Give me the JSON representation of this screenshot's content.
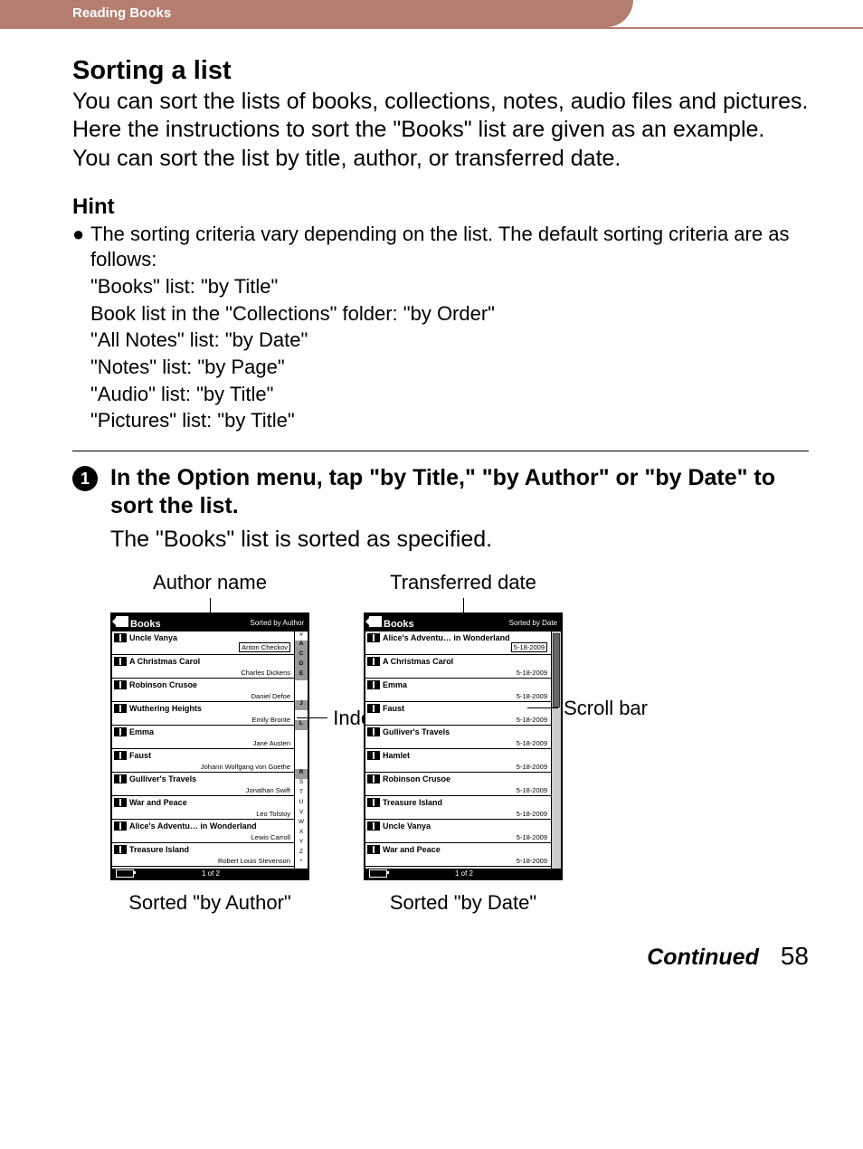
{
  "header": {
    "breadcrumb": "Reading Books"
  },
  "title": "Sorting a list",
  "intro": "You can sort the lists of books, collections, notes, audio files and pictures.\nHere the instructions to sort the \"Books\" list are given as an example. You can sort the list by title, author, or transferred date.",
  "hint_heading": "Hint",
  "hint_lead": "The sorting criteria vary depending on the list. The default sorting criteria are as follows:",
  "hint_criteria": [
    "\"Books\" list: \"by Title\"",
    "Book list in the \"Collections\" folder: \"by Order\"",
    "\"All Notes\" list: \"by Date\"",
    "\"Notes\" list: \"by Page\"",
    "\"Audio\" list: \"by Title\"",
    "\"Pictures\" list: \"by Title\""
  ],
  "step": {
    "num": "1",
    "title": "In the Option menu, tap \"by Title,\" \"by Author\" or \"by Date\" to sort the list.",
    "body": "The \"Books\" list is sorted as specified."
  },
  "callouts": {
    "author_name": "Author name",
    "transferred_date": "Transferred date",
    "index_bar": "Index bar",
    "scroll_bar": "Scroll bar"
  },
  "screen_author": {
    "header_title": "Books",
    "sort_mode": "Sorted by Author",
    "rows": [
      {
        "title": "Uncle Vanya",
        "sub": "Anton Checkov",
        "boxed": true
      },
      {
        "title": "A Christmas Carol",
        "sub": "Charles Dickens"
      },
      {
        "title": "Robinson Crusoe",
        "sub": "Daniel Defoe"
      },
      {
        "title": "Wuthering Heights",
        "sub": "Emily Bronte"
      },
      {
        "title": "Emma",
        "sub": "Jane Austen"
      },
      {
        "title": "Faust",
        "sub": "Johann Wolfgang von Goethe"
      },
      {
        "title": "Gulliver's Travels",
        "sub": "Jonathan Swift"
      },
      {
        "title": "War and Peace",
        "sub": "Leo Tolstoy"
      },
      {
        "title": "Alice's Adventu… in Wonderland",
        "sub": "Lewis Carroll"
      },
      {
        "title": "Treasure Island",
        "sub": "Robert Louis Stevenson"
      }
    ],
    "index": [
      "#",
      "A",
      "C",
      "D",
      "E",
      "",
      "",
      "J",
      "",
      "L",
      "",
      "",
      "",
      "",
      "R",
      "S",
      "T",
      "U",
      "V",
      "W",
      "X",
      "Y",
      "Z",
      "*"
    ],
    "footer_page": "1 of 2",
    "caption": "Sorted \"by Author\""
  },
  "screen_date": {
    "header_title": "Books",
    "sort_mode": "Sorted by Date",
    "rows": [
      {
        "title": "Alice's Adventu… in Wonderland",
        "sub": "5-18-2009",
        "boxed": true
      },
      {
        "title": "A Christmas Carol",
        "sub": "5-18-2009"
      },
      {
        "title": "Emma",
        "sub": "5-18-2009"
      },
      {
        "title": "Faust",
        "sub": "5-18-2009"
      },
      {
        "title": "Gulliver's Travels",
        "sub": "5-18-2009"
      },
      {
        "title": "Hamlet",
        "sub": "5-18-2009"
      },
      {
        "title": "Robinson Crusoe",
        "sub": "5-18-2009"
      },
      {
        "title": "Treasure Island",
        "sub": "5-18-2009"
      },
      {
        "title": "Uncle Vanya",
        "sub": "5-18-2009"
      },
      {
        "title": "War and Peace",
        "sub": "5-18-2009"
      }
    ],
    "footer_page": "1 of 2",
    "caption": "Sorted \"by Date\""
  },
  "footer": {
    "continued": "Continued",
    "page": "58"
  }
}
